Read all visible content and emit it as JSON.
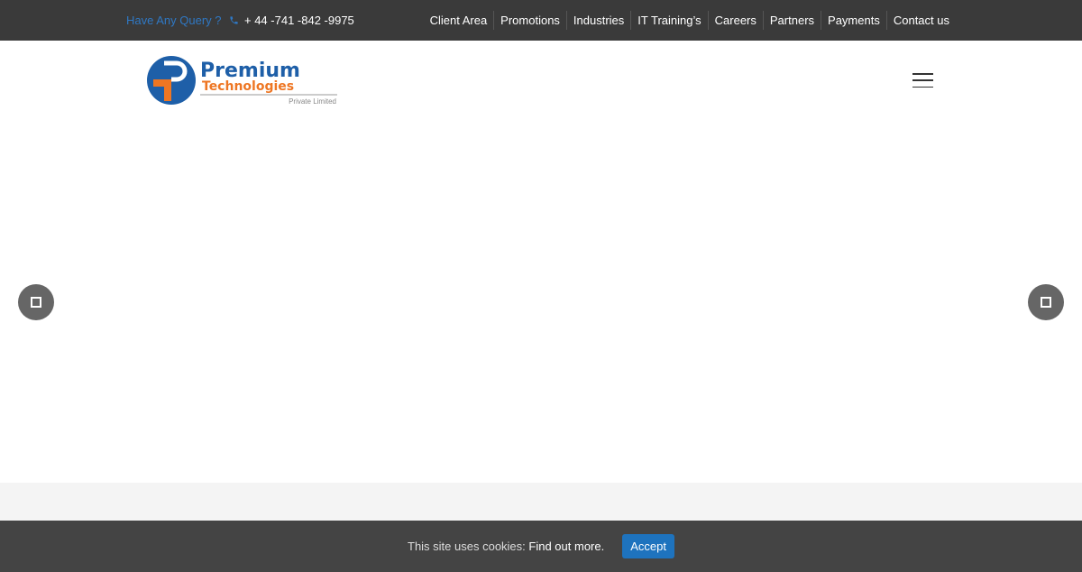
{
  "topbar": {
    "query": "Have Any Query ?",
    "phone": "+ 44 -741 -842 -9975",
    "phone_icon": "phone-icon",
    "nav": [
      "Client Area",
      "Promotions",
      "Industries",
      "IT Training’s",
      "Careers",
      "Partners",
      "Payments",
      "Contact us"
    ]
  },
  "logo": {
    "line1": "Premium",
    "line2": "Technologies",
    "line3": "Private Limited"
  },
  "colors": {
    "accent": "#1e73be",
    "topbar": "#3a3a3a",
    "logo_orange": "#ee7623"
  },
  "cookie": {
    "text": "This site uses cookies:",
    "link": "Find out more.",
    "accept": "Accept"
  }
}
